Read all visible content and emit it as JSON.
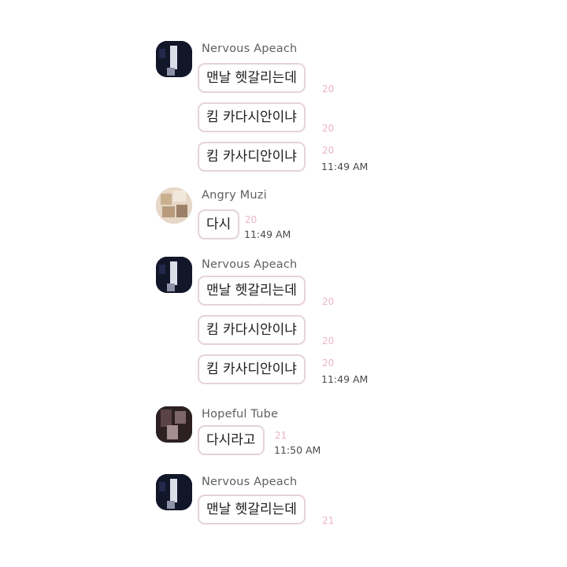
{
  "chat": {
    "groups": [
      {
        "sender": "Nervous Apeach",
        "messages": [
          {
            "text": "맨날 헷갈리는데",
            "count": "20"
          },
          {
            "text": "킴 카다시안이냐",
            "count": "20"
          },
          {
            "text": "킴 카사디안이냐",
            "count": "20",
            "time": "11:49 AM"
          }
        ]
      },
      {
        "sender": "Angry Muzi",
        "messages": [
          {
            "text": "다시",
            "count": "20",
            "time": "11:49 AM"
          }
        ]
      },
      {
        "sender": "Nervous Apeach",
        "messages": [
          {
            "text": "맨날 헷갈리는데",
            "count": "20"
          },
          {
            "text": "킴 카다시안이냐",
            "count": "20"
          },
          {
            "text": "킴 카사디안이냐",
            "count": "20",
            "time": "11:49 AM"
          }
        ]
      },
      {
        "sender": "Hopeful Tube",
        "messages": [
          {
            "text": "다시라고",
            "count": "21",
            "time": "11:50 AM"
          }
        ]
      },
      {
        "sender": "Nervous Apeach",
        "messages": [
          {
            "text": "맨날 헷갈리는데",
            "count": "21"
          }
        ]
      }
    ]
  },
  "colors": {
    "bubble_border": "#e6d3d7",
    "unread_count": "#ecb4c3",
    "sender_name": "#5f5f5f",
    "timestamp": "#4a4a4a"
  }
}
